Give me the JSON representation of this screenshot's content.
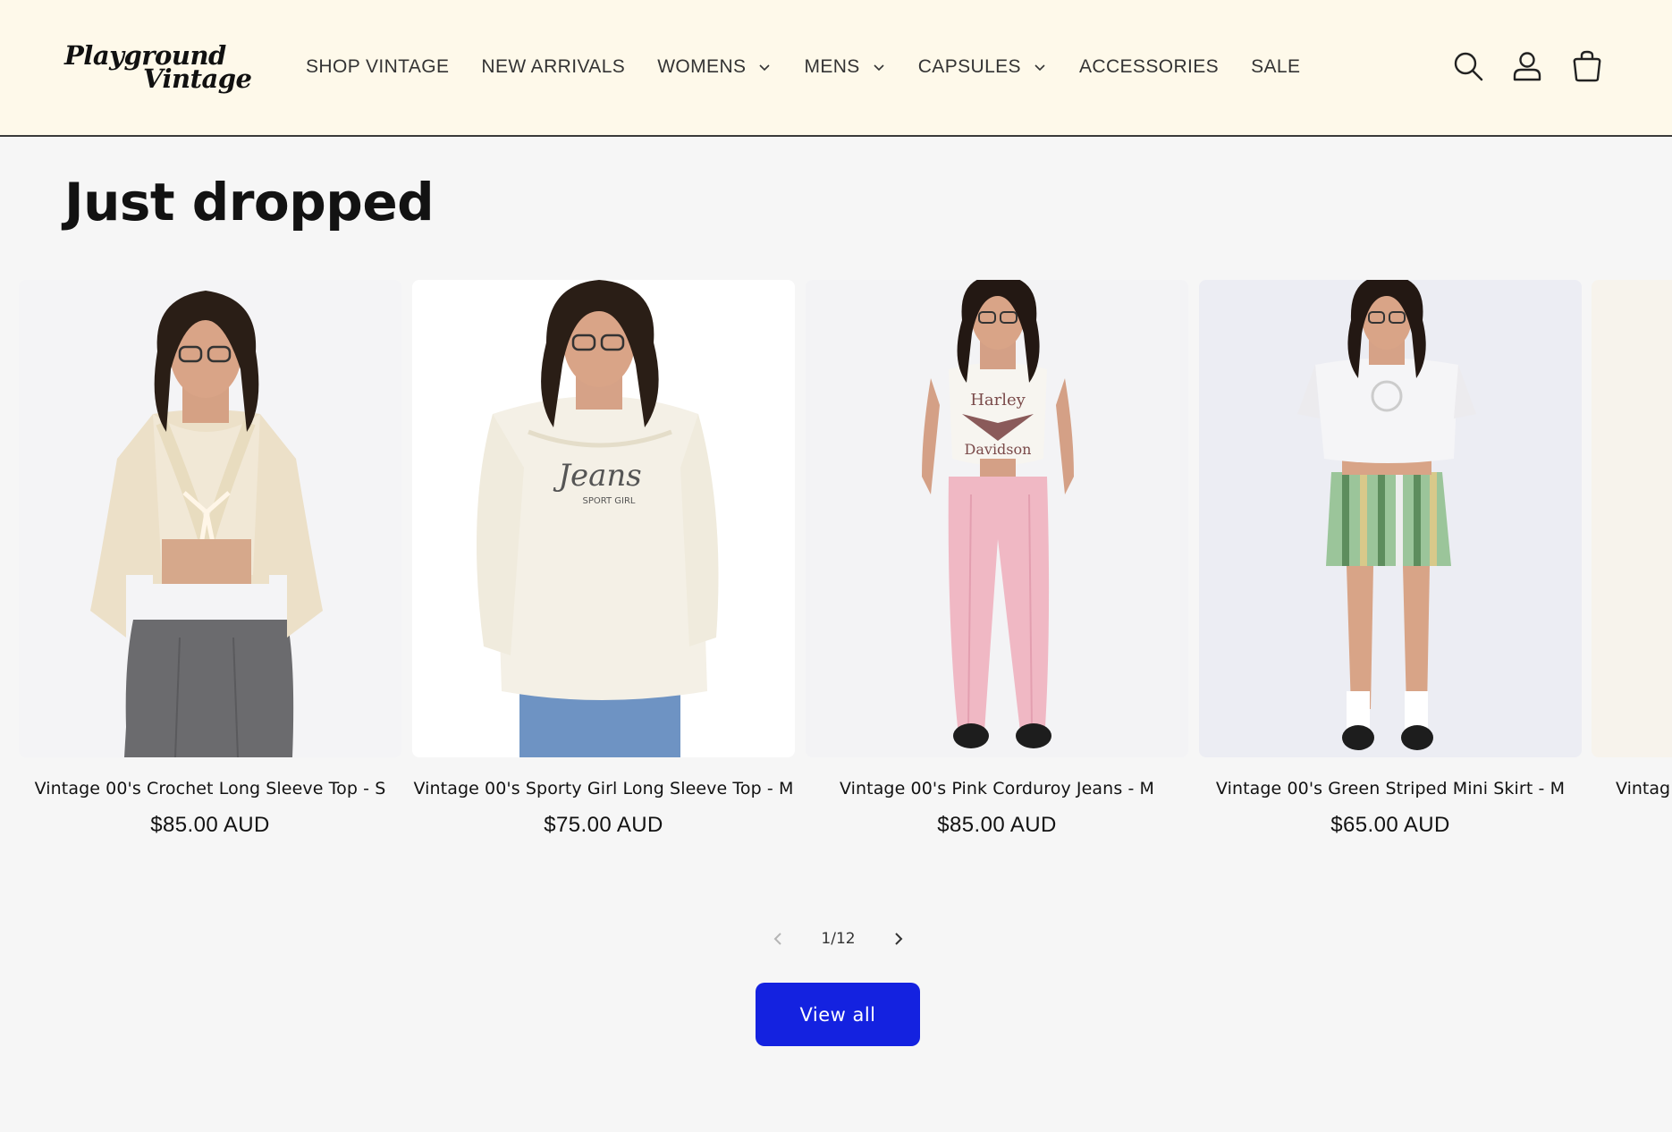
{
  "brand": {
    "line1": "Playground",
    "line2": "Vintage"
  },
  "nav": {
    "items": [
      {
        "label": "SHOP VINTAGE",
        "dropdown": false
      },
      {
        "label": "NEW ARRIVALS",
        "dropdown": false
      },
      {
        "label": "WOMENS",
        "dropdown": true
      },
      {
        "label": "MENS",
        "dropdown": true
      },
      {
        "label": "CAPSULES",
        "dropdown": true
      },
      {
        "label": "ACCESSORIES",
        "dropdown": false
      },
      {
        "label": "SALE",
        "dropdown": false
      }
    ]
  },
  "header_icons": [
    "search-icon",
    "account-icon",
    "cart-icon"
  ],
  "section": {
    "title": "Just dropped"
  },
  "products": [
    {
      "name": "Vintage 00's Crochet Long Sleeve Top - S",
      "price": "$85.00 AUD"
    },
    {
      "name": "Vintage 00's Sporty Girl Long Sleeve Top - M",
      "price": "$75.00 AUD"
    },
    {
      "name": "Vintage 00's Pink Corduroy Jeans - M",
      "price": "$85.00 AUD"
    },
    {
      "name": "Vintage 00's Green Striped Mini Skirt - M",
      "price": "$65.00 AUD"
    }
  ],
  "partial_product": {
    "name": "Vintag"
  },
  "pager": {
    "count": "1/12"
  },
  "cta": {
    "label": "View all"
  },
  "colors": {
    "header_bg": "#fef9ea",
    "page_bg": "#f6f6f6",
    "cta_bg": "#1422e0",
    "text": "#121212"
  }
}
